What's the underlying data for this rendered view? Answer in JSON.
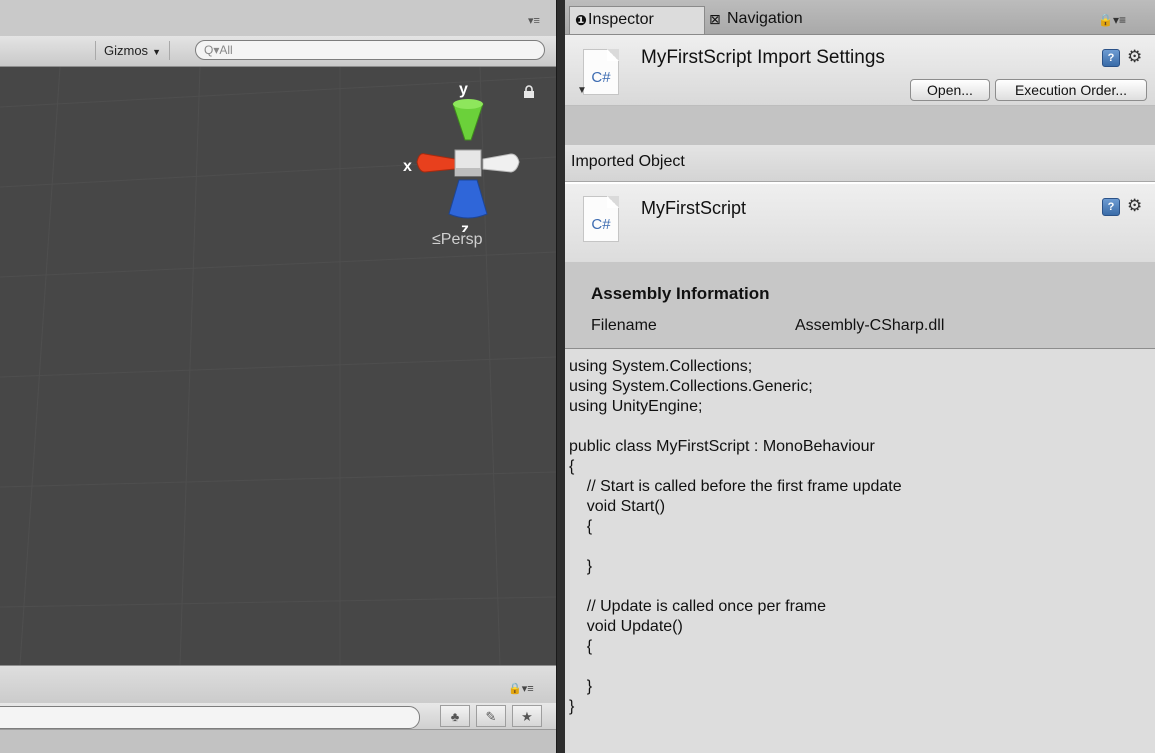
{
  "scene": {
    "menu_glyph": "▾≡",
    "gizmos_label": "Gizmos",
    "search_placeholder": "Q▾All",
    "axis_x": "x",
    "axis_y": "y",
    "axis_z": "z",
    "persp_label": "≤Persp",
    "bottom_lock_menu": "🔒▾≡"
  },
  "inspector": {
    "tabs": [
      {
        "label": "Inspector",
        "icon": "info-icon"
      },
      {
        "label": "Navigation",
        "icon": "navmesh-icon"
      }
    ],
    "header_title": "MyFirstScript Import Settings",
    "file_icon_label": "C#",
    "buttons": {
      "open": "Open...",
      "execution_order": "Execution Order..."
    },
    "imported_object_label": "Imported Object",
    "object_title": "MyFirstScript",
    "assembly": {
      "title": "Assembly Information",
      "filename_label": "Filename",
      "filename_value": "Assembly-CSharp.dll"
    },
    "code": "using System.Collections;\nusing System.Collections.Generic;\nusing UnityEngine;\n\npublic class MyFirstScript : MonoBehaviour\n{\n    // Start is called before the first frame update\n    void Start()\n    {\n\n    }\n\n    // Update is called once per frame\n    void Update()\n    {\n\n    }\n}"
  }
}
